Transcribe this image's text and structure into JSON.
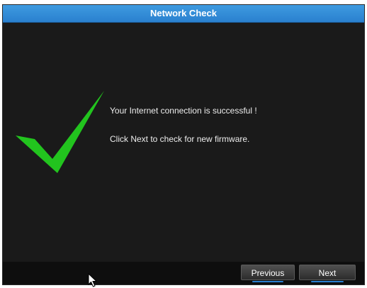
{
  "window": {
    "title": "Network Check"
  },
  "main": {
    "status_icon": "green-checkmark-icon",
    "message": "Your Internet connection is successful !",
    "instruction": "Click Next to check for new firmware."
  },
  "footer": {
    "previous_label": "Previous",
    "next_label": "Next"
  },
  "colors": {
    "titlebar": "#2a80cf",
    "background": "#1a1a1a",
    "checkmark": "#22c41e",
    "button_accent": "#2a7fd0"
  }
}
